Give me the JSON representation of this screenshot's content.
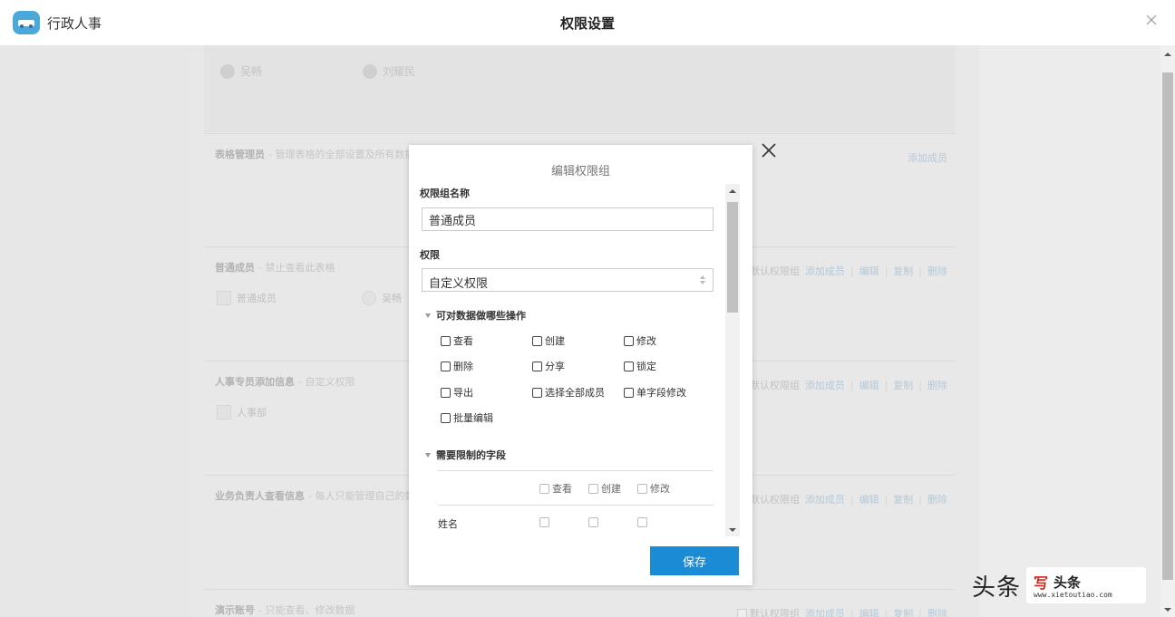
{
  "app": {
    "name": "行政人事"
  },
  "header": {
    "title": "权限设置"
  },
  "background": {
    "members": [
      "吴畅",
      "刘耀民"
    ],
    "groups": [
      {
        "name": "表格管理员",
        "desc": "- 管理表格的全部设置及所有数据",
        "actions": [
          "添加成员"
        ],
        "members": []
      },
      {
        "name": "普通成员",
        "desc": "- 禁止查看此表格",
        "actions": [
          "默认权限组",
          "添加成员",
          "编辑",
          "复制",
          "删除"
        ],
        "members": [
          "普通成员",
          "吴畅"
        ]
      },
      {
        "name": "人事专员添加信息",
        "desc": "- 自定义权限",
        "actions": [
          "默认权限组",
          "添加成员",
          "编辑",
          "复制",
          "删除"
        ],
        "members": [
          "人事部"
        ]
      },
      {
        "name": "业务负责人查看信息",
        "desc": "- 每人只能管理自己的数据",
        "actions": [
          "默认权限组",
          "添加成员",
          "编辑",
          "复制",
          "删除"
        ],
        "members": []
      },
      {
        "name": "演示账号",
        "desc": "- 只能查看、修改数据",
        "actions": [
          "默认权限组",
          "添加成员",
          "编辑",
          "复制",
          "删除"
        ],
        "members": []
      }
    ]
  },
  "modal": {
    "title": "编辑权限组",
    "name_label": "权限组名称",
    "name_value": "普通成员",
    "perm_label": "权限",
    "perm_value": "自定义权限",
    "ops_section": "可对数据做哪些操作",
    "ops": [
      "查看",
      "创建",
      "修改",
      "删除",
      "分享",
      "锁定",
      "导出",
      "选择全部成员",
      "单字段修改",
      "批量编辑"
    ],
    "fields_section": "需要限制的字段",
    "field_columns": [
      "查看",
      "创建",
      "修改"
    ],
    "field_rows": [
      "姓名"
    ],
    "save_label": "保存"
  },
  "watermark": {
    "text": "头条",
    "brand": "头条",
    "site": "www.xietoutiao.com",
    "glyph": "写"
  },
  "colors": {
    "accent": "#1c8bd6",
    "logo": "#4aa8db"
  }
}
